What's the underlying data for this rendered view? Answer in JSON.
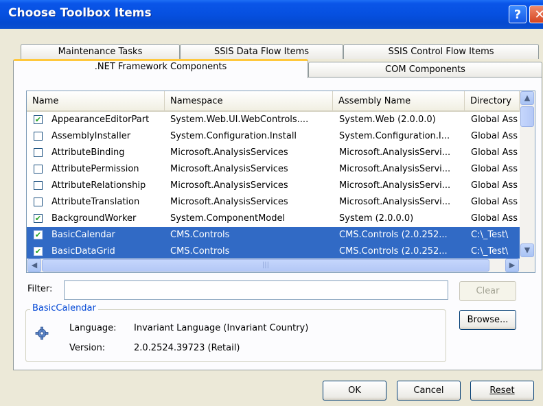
{
  "window": {
    "title": "Choose Toolbox Items",
    "help_glyph": "?",
    "close_glyph": "✕"
  },
  "tabs": {
    "back": [
      "Maintenance Tasks",
      "SSIS Data Flow Items",
      "SSIS Control Flow Items"
    ],
    "front": [
      ".NET Framework Components",
      "COM Components"
    ],
    "active": ".NET Framework Components"
  },
  "list": {
    "columns": [
      "Name",
      "Namespace",
      "Assembly Name",
      "Directory"
    ],
    "rows": [
      {
        "checked": true,
        "selected": false,
        "name": "AppearanceEditorPart",
        "namespace": "System.Web.UI.WebControls....",
        "assembly": "System.Web (2.0.0.0)",
        "directory": "Global Ass"
      },
      {
        "checked": false,
        "selected": false,
        "name": "AssemblyInstaller",
        "namespace": "System.Configuration.Install",
        "assembly": "System.Configuration.I...",
        "directory": "Global Ass"
      },
      {
        "checked": false,
        "selected": false,
        "name": "AttributeBinding",
        "namespace": "Microsoft.AnalysisServices",
        "assembly": "Microsoft.AnalysisServi...",
        "directory": "Global Ass"
      },
      {
        "checked": false,
        "selected": false,
        "name": "AttributePermission",
        "namespace": "Microsoft.AnalysisServices",
        "assembly": "Microsoft.AnalysisServi...",
        "directory": "Global Ass"
      },
      {
        "checked": false,
        "selected": false,
        "name": "AttributeRelationship",
        "namespace": "Microsoft.AnalysisServices",
        "assembly": "Microsoft.AnalysisServi...",
        "directory": "Global Ass"
      },
      {
        "checked": false,
        "selected": false,
        "name": "AttributeTranslation",
        "namespace": "Microsoft.AnalysisServices",
        "assembly": "Microsoft.AnalysisServi...",
        "directory": "Global Ass"
      },
      {
        "checked": true,
        "selected": false,
        "name": "BackgroundWorker",
        "namespace": "System.ComponentModel",
        "assembly": "System (2.0.0.0)",
        "directory": "Global Ass"
      },
      {
        "checked": true,
        "selected": true,
        "name": "BasicCalendar",
        "namespace": "CMS.Controls",
        "assembly": "CMS.Controls (2.0.252...",
        "directory": "C:\\_Test\\"
      },
      {
        "checked": true,
        "selected": true,
        "name": "BasicDataGrid",
        "namespace": "CMS.Controls",
        "assembly": "CMS.Controls (2.0.252...",
        "directory": "C:\\_Test\\"
      }
    ],
    "scroll_up": "▲",
    "scroll_down": "▼",
    "scroll_left": "◀",
    "scroll_right": "▶",
    "grip": "|||"
  },
  "filter": {
    "label": "Filter:",
    "value": "",
    "clear_label": "Clear"
  },
  "details": {
    "title": "BasicCalendar",
    "language_label": "Language:",
    "language_value": "Invariant Language (Invariant Country)",
    "version_label": "Version:",
    "version_value": "2.0.2524.39723 (Retail)"
  },
  "buttons": {
    "browse": "Browse...",
    "ok": "OK",
    "cancel": "Cancel",
    "reset": "Reset"
  },
  "check_glyph": "✔",
  "colors": {
    "title_bar": "#0650e0",
    "selection": "#316ac5",
    "group_title": "#0046d5",
    "active_tab_accent": "#ffc83c"
  }
}
